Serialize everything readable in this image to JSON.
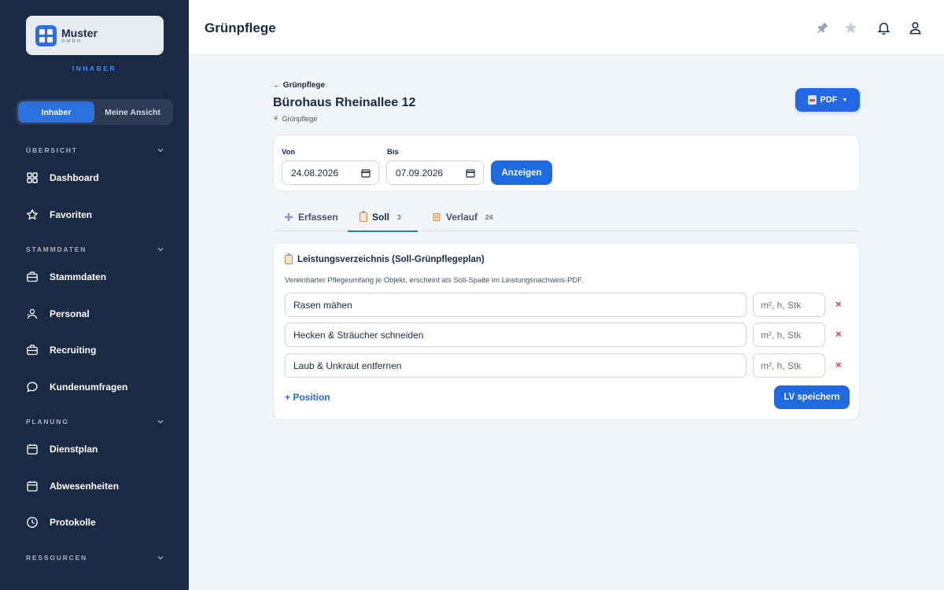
{
  "brand": {
    "name": "Muster",
    "subtitle": "GMBH",
    "role": "INHABER"
  },
  "role_toggle": {
    "active": "Inhaber",
    "other": "Meine Ansicht"
  },
  "sidebar": {
    "sections": [
      {
        "label": "ÜBERSICHT",
        "items": [
          {
            "label": "Dashboard",
            "icon": "grid-icon"
          },
          {
            "label": "Favoriten",
            "icon": "star-icon"
          }
        ]
      },
      {
        "label": "STAMMDATEN",
        "items": [
          {
            "label": "Stammdaten",
            "icon": "briefcase-icon"
          },
          {
            "label": "Personal",
            "icon": "users-icon"
          },
          {
            "label": "Recruiting",
            "icon": "briefcase-icon"
          },
          {
            "label": "Kundenumfragen",
            "icon": "chat-icon"
          }
        ]
      },
      {
        "label": "PLANUNG",
        "items": [
          {
            "label": "Dienstplan",
            "icon": "calendar-icon"
          },
          {
            "label": "Abwesenheiten",
            "icon": "calendar-icon"
          },
          {
            "label": "Protokolle",
            "icon": "clock-icon"
          }
        ]
      },
      {
        "label": "RESSOURCEN",
        "items": []
      }
    ]
  },
  "header": {
    "title": "Grünpflege"
  },
  "page": {
    "back_label": "← Grünpflege",
    "title": "Bürohaus Rheinallee 12",
    "subtitle": "Grünpflege",
    "pdf_label": "PDF"
  },
  "filters": {
    "from_label": "Von",
    "from_value": "24.08.2026",
    "to_label": "Bis",
    "to_value": "07.09.2026",
    "submit_label": "Anzeigen"
  },
  "tabs": [
    {
      "label": "Erfassen",
      "count": ""
    },
    {
      "label": "Soll",
      "count": "3"
    },
    {
      "label": "Verlauf",
      "count": "24"
    }
  ],
  "lv": {
    "title": "Leistungsverzeichnis (Soll-Grünpflegeplan)",
    "description": "Vereinbarter Pflegeumfang je Objekt, erscheint als Soll-Spalte im Leistungsnachweis-PDF.",
    "unit_placeholder": "m², h, Stk",
    "rows": [
      {
        "value": "Rasen mähen"
      },
      {
        "value": "Hecken & Sträucher schneiden"
      },
      {
        "value": "Laub & Unkraut entfernen"
      }
    ],
    "delete_symbol": "×",
    "add_label": "+ Position",
    "save_label": "LV speichern"
  },
  "colors": {
    "sidebar": "#1b2a44",
    "accent": "#2367e3",
    "danger": "#d43b3b"
  }
}
